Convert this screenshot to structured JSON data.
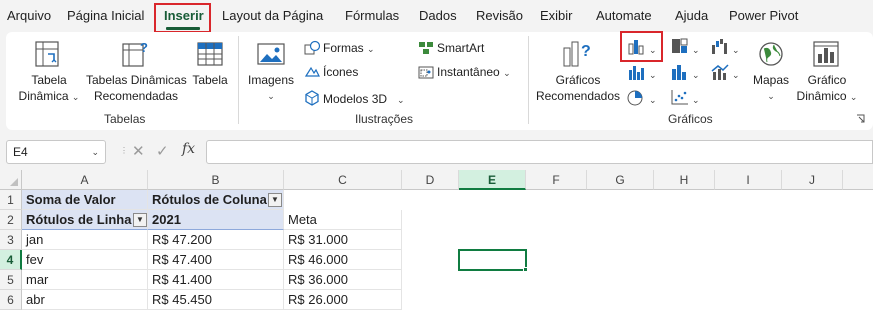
{
  "tabs": [
    "Arquivo",
    "Página Inicial",
    "Inserir",
    "Layout da Página",
    "Fórmulas",
    "Dados",
    "Revisão",
    "Exibir",
    "Automate",
    "Ajuda",
    "Power Pivot"
  ],
  "active_tab": "Inserir",
  "ribbon": {
    "tabelas": {
      "group_label": "Tabelas",
      "tabela_dinamica": [
        "Tabela",
        "Dinâmica"
      ],
      "tabelas_dinamicas_rec": [
        "Tabelas Dinâmicas",
        "Recomendadas"
      ],
      "tabela": "Tabela"
    },
    "ilustracoes": {
      "group_label": "Ilustrações",
      "imagens": "Imagens",
      "formas": "Formas",
      "icones": "Ícones",
      "modelos3d": "Modelos 3D",
      "smartart": "SmartArt",
      "instantaneo": "Instantâneo"
    },
    "graficos": {
      "group_label": "Gráficos",
      "recomendados": [
        "Gráficos",
        "Recomendados"
      ],
      "mapas": "Mapas",
      "grafico_dinamico": [
        "Gráfico",
        "Dinâmico"
      ]
    }
  },
  "formula_bar": {
    "name_box": "E4",
    "fx": "fx",
    "formula": ""
  },
  "colors": {
    "accent": "#107c41",
    "active_tab": "#185c37",
    "highlight_box": "#d9262b",
    "pivot_header": "#dce3f3"
  },
  "sheet": {
    "columns": [
      "A",
      "B",
      "C",
      "D",
      "E",
      "F",
      "G",
      "H",
      "I",
      "J"
    ],
    "rows": [
      "1",
      "2",
      "3",
      "4",
      "5",
      "6"
    ],
    "selected_cell": "E4",
    "pivot": {
      "r1": [
        "Soma de Valor",
        "Rótulos de Coluna"
      ],
      "r2": [
        "Rótulos de Linha",
        "2021",
        "Meta"
      ],
      "data": [
        [
          "jan",
          "R$ 47.200",
          "R$ 31.000"
        ],
        [
          "fev",
          "R$ 47.400",
          "R$ 46.000"
        ],
        [
          "mar",
          "R$ 41.400",
          "R$ 36.000"
        ],
        [
          "abr",
          "R$ 45.450",
          "R$ 26.000"
        ]
      ]
    }
  }
}
